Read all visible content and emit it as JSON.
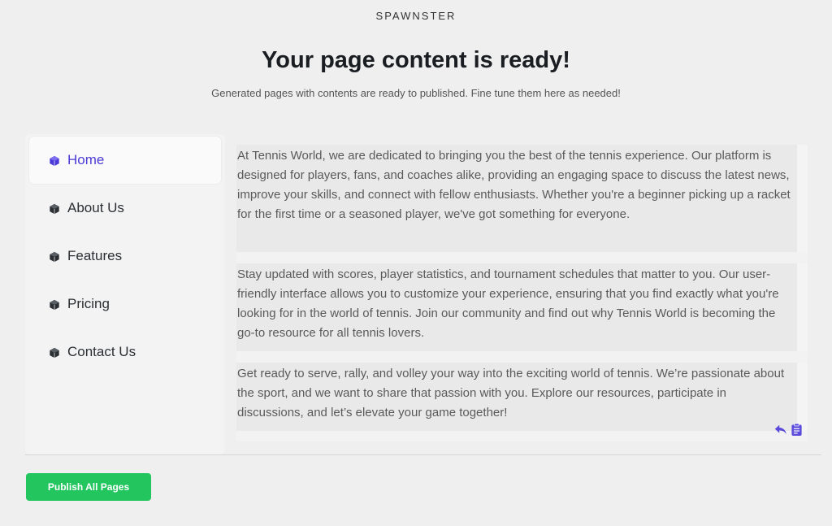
{
  "brand": "SPAWNSTER",
  "header": {
    "title": "Your page content is ready!",
    "subtitle": "Generated pages with contents are ready to published. Fine tune them here as needed!"
  },
  "sidebar": {
    "active": "Home",
    "items": [
      {
        "label": "Home",
        "icon": "cube-icon"
      },
      {
        "label": "About Us",
        "icon": "cube-icon"
      },
      {
        "label": "Features",
        "icon": "cube-icon"
      },
      {
        "label": "Pricing",
        "icon": "cube-icon"
      },
      {
        "label": "Contact Us",
        "icon": "cube-icon"
      }
    ]
  },
  "content": {
    "paragraphs": [
      "At Tennis World, we are dedicated to bringing you the best of the tennis experience. Our platform is designed for players, fans, and coaches alike, providing an engaging space to discuss the latest news, improve your skills, and connect with fellow enthusiasts. Whether you're a beginner picking up a racket for the first time or a seasoned player, we've got something for everyone.",
      "Stay updated with scores, player statistics, and tournament schedules that matter to you. Our user-friendly interface allows you to customize your experience, ensuring that you find exactly what you're looking for in the world of tennis. Join our community and find out why Tennis World is becoming the go-to resource for all tennis lovers.",
      "Get ready to serve, rally, and volley your way into the exciting world of tennis. We’re passionate about the sport, and we want to share that passion with you. Explore our resources, participate in discussions, and let’s elevate your game together!"
    ],
    "actions": [
      {
        "icon": "undo-icon"
      },
      {
        "icon": "clipboard-icon"
      }
    ]
  },
  "footer": {
    "publish_label": "Publish All Pages"
  },
  "colors": {
    "accent": "#4b3ad6",
    "action_icon": "#5b4bdc",
    "publish_button": "#22c55e",
    "background": "#efefef"
  }
}
